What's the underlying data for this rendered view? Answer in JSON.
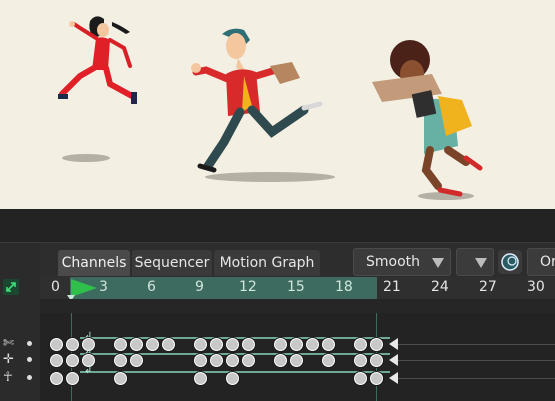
{
  "tabs": [
    {
      "label": "Channels",
      "active": true
    },
    {
      "label": "Sequencer",
      "active": false
    },
    {
      "label": "Motion Graph",
      "active": false
    }
  ],
  "interpolation": {
    "selected": "Smooth"
  },
  "extra_dropdown": {
    "label": "Or"
  },
  "ruler": {
    "ticks": [
      "0",
      "3",
      "6",
      "9",
      "12",
      "15",
      "18",
      "21",
      "24",
      "27",
      "30"
    ],
    "range_start": 0,
    "range_end": 20,
    "current_frame": 1
  },
  "track_header": {
    "left_number": "0",
    "right_number": "1"
  },
  "tracks": [
    {
      "icon": "bone-link-icon",
      "keys": [
        0,
        1,
        2,
        4,
        5,
        6,
        7,
        9,
        10,
        11,
        12,
        14,
        15,
        16,
        17,
        19,
        20
      ]
    },
    {
      "icon": "bone-move-icon",
      "keys": [
        0,
        1,
        2,
        4,
        5,
        9,
        10,
        11,
        12,
        14,
        15,
        17,
        19,
        20
      ]
    },
    {
      "icon": "bone-icon",
      "keys": [
        0,
        1,
        4,
        9,
        11,
        19,
        20
      ]
    }
  ],
  "colors": {
    "accent": "#3e6b60",
    "playhead": "#2fbf4a",
    "track_line": "#6fa899",
    "viewport_bg": "#f3efe3"
  }
}
